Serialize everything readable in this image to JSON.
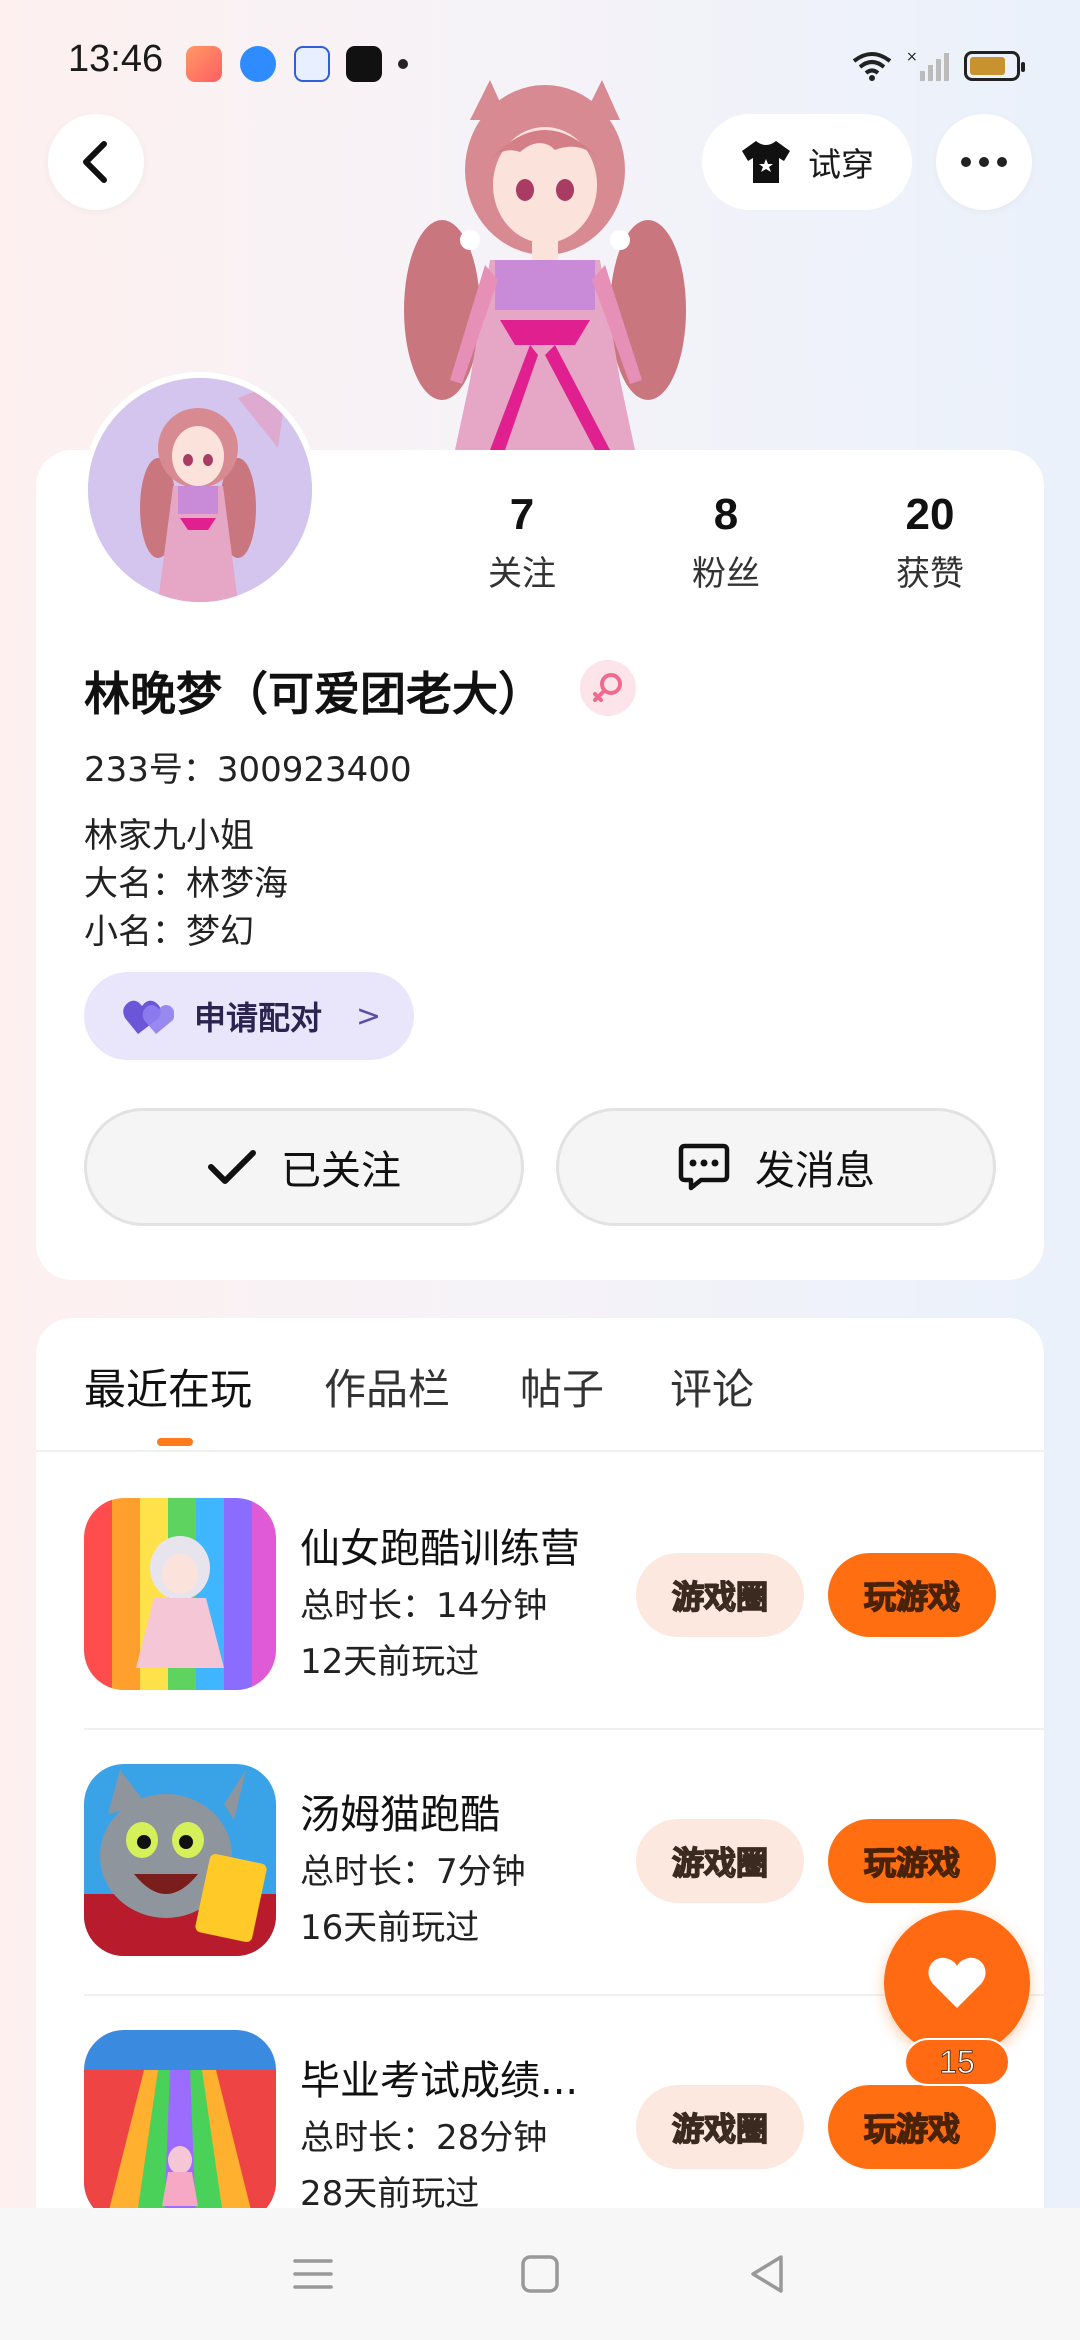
{
  "status_bar": {
    "time": "13:46",
    "battery_level": 0.8,
    "app_icons": [
      "game-controller-icon",
      "browser-icon",
      "baidu-icon",
      "tiktok-icon"
    ]
  },
  "header": {
    "try_on_label": "试穿"
  },
  "profile": {
    "username": "林晚梦（可爱团老大）",
    "uid": "233号：300923400",
    "gender": "female",
    "stats": [
      {
        "value": "7",
        "label": "关注"
      },
      {
        "value": "8",
        "label": "粉丝"
      },
      {
        "value": "20",
        "label": "获赞"
      }
    ],
    "bio": [
      "林家九小姐",
      "大名：林梦海",
      "小名：梦幻"
    ],
    "pair_label": "申请配对",
    "follow_label": "已关注",
    "message_label": "发消息"
  },
  "tabs": [
    {
      "label": "最近在玩",
      "active": true
    },
    {
      "label": "作品栏",
      "active": false
    },
    {
      "label": "帖子",
      "active": false
    },
    {
      "label": "评论",
      "active": false
    }
  ],
  "games": [
    {
      "title": "仙女跑酷训练营",
      "duration": "总时长：14分钟",
      "last_played": "12天前玩过",
      "circle_label": "游戏圈",
      "play_label": "玩游戏"
    },
    {
      "title": "汤姆猫跑酷",
      "duration": "总时长：7分钟",
      "last_played": "16天前玩过",
      "circle_label": "游戏圈",
      "play_label": "玩游戏"
    },
    {
      "title": "毕业考试成绩...",
      "duration": "总时长：28分钟",
      "last_played": "28天前玩过",
      "circle_label": "游戏圈",
      "play_label": "玩游戏"
    }
  ],
  "like": {
    "count": "15"
  },
  "colors": {
    "accent": "#ff6e10",
    "pair_bg": "#e9e6fb",
    "circle_btn_bg": "#fde8df"
  }
}
